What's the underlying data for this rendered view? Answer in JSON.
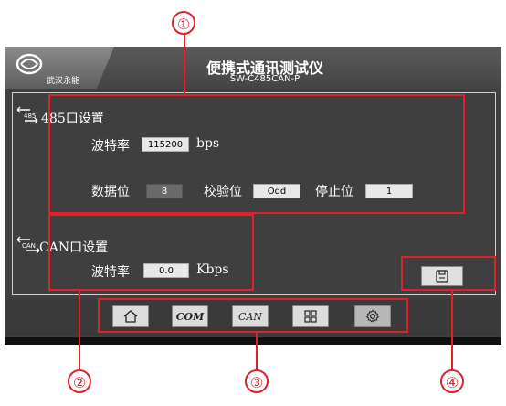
{
  "header": {
    "title": "便携式通讯测试仪",
    "model": "SW-C485CAN-P",
    "logo_text": "武汉永能"
  },
  "rs485": {
    "icon_text": "485",
    "section_title": "485口设置",
    "baud_label": "波特率",
    "baud_value": "115200",
    "baud_unit": "bps",
    "databits_label": "数据位",
    "databits_value": "8",
    "parity_label": "校验位",
    "parity_value": "Odd",
    "stopbits_label": "停止位",
    "stopbits_value": "1"
  },
  "can": {
    "icon_text": "CAN",
    "section_title": "CAN口设置",
    "baud_label": "波特率",
    "baud_value": "0.0",
    "baud_unit": "Kbps"
  },
  "nav": {
    "com_label": "COM",
    "can_label": "CAN"
  },
  "annotations": [
    "①",
    "②",
    "③",
    "④"
  ],
  "colors": {
    "annotation_red": "#e0202a",
    "screen_bg": "#3f3f3f"
  }
}
